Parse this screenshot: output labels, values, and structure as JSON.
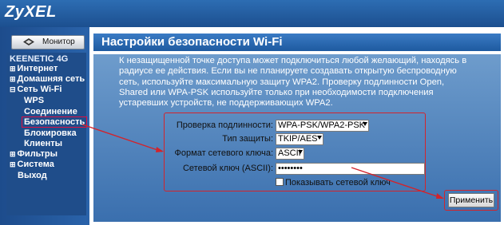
{
  "header": {
    "logo": "ZyXEL"
  },
  "sidebar": {
    "monitor_label": "Монитор",
    "nav_title": "KEENETIC 4G",
    "items": [
      {
        "label": "Интернет",
        "expand": "⊞"
      },
      {
        "label": "Домашняя сеть",
        "expand": "⊞"
      },
      {
        "label": "Сеть Wi-Fi",
        "expand": "⊟"
      },
      {
        "label": "WPS"
      },
      {
        "label": "Соединение"
      },
      {
        "label": "Безопасность"
      },
      {
        "label": "Блокировка"
      },
      {
        "label": "Клиенты"
      },
      {
        "label": "Фильтры",
        "expand": "⊞"
      },
      {
        "label": "Система",
        "expand": "⊞"
      },
      {
        "label": "Выход"
      }
    ]
  },
  "main": {
    "title": "Настройки безопасности Wi-Fi",
    "description": [
      "К незащищенной точке доступа может подключиться любой желающий, находясь в",
      "радиусе ее действия. Если вы не планируете создавать открытую беспроводную",
      "сеть, используйте максимальную защиту WPA2. Проверку подлинности Open,",
      "Shared или WPA-PSK используйте только при необходимости подключения",
      "устаревших устройств, не поддерживающих WPA2."
    ],
    "form": {
      "auth_label": "Проверка подлинности:",
      "auth_value": "WPA-PSK/WPA2-PSK",
      "protection_label": "Тип защиты:",
      "protection_value": "TKIP/AES",
      "key_format_label": "Формат сетевого ключа:",
      "key_format_value": "ASCII",
      "key_label": "Сетевой ключ (ASCII):",
      "key_value": "••••••••",
      "show_key_label": "Показывать сетевой ключ"
    },
    "apply_label": "Применить"
  },
  "colors": {
    "accent_red": "#d2242c",
    "header_blue": "#1c4f8f",
    "panel_blue": "#3a6fae"
  }
}
